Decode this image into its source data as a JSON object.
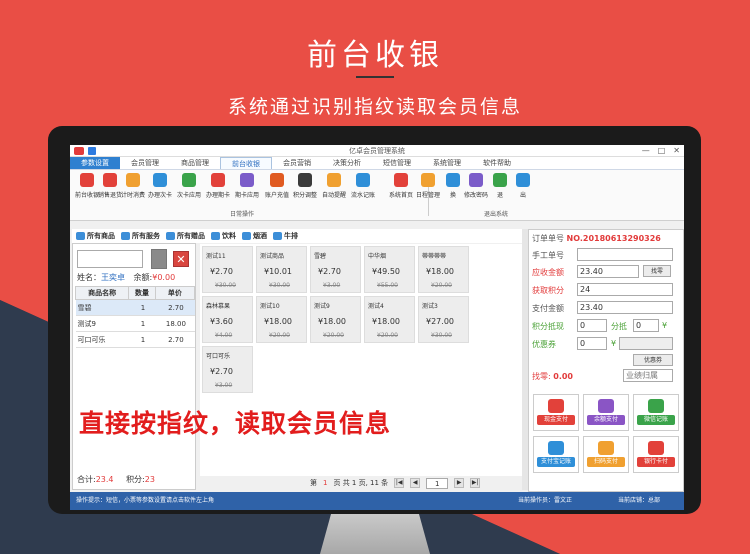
{
  "hero": {
    "title": "前台收银",
    "subtitle": "系统通过识别指纹读取会员信息"
  },
  "app": {
    "title": "亿卓会员管理系统",
    "min": "—",
    "max": "□",
    "close": "✕"
  },
  "menu": {
    "tabs": [
      "参数设置",
      "会员管理",
      "商品管理",
      "前台收银",
      "会员营销",
      "决策分析",
      "短信管理",
      "系统管理",
      "软件帮助"
    ]
  },
  "ribbon": {
    "buttons": [
      {
        "label": "前台收银",
        "color": "#e2413a"
      },
      {
        "label": "销售退货",
        "color": "#e2413a"
      },
      {
        "label": "计时消费",
        "color": "#f0a030"
      },
      {
        "label": "办理次卡",
        "color": "#2f8fd8"
      },
      {
        "label": "次卡应用",
        "color": "#3aa34a"
      },
      {
        "label": "办理期卡",
        "color": "#e2413a"
      },
      {
        "label": "期卡应用",
        "color": "#7b5cc9"
      },
      {
        "label": "账户充值",
        "color": "#e05a20"
      },
      {
        "label": "积分调整",
        "color": "#3a3a3a"
      },
      {
        "label": "自动提醒",
        "color": "#f0a030"
      },
      {
        "label": "流水记账",
        "color": "#2f8fd8"
      },
      {
        "label": "系统首页",
        "color": "#e2413a"
      },
      {
        "label": "日程管理",
        "color": "#f0a030"
      },
      {
        "label": "换",
        "color": "#2f8fd8"
      },
      {
        "label": "修改密码",
        "color": "#7b5cc9"
      },
      {
        "label": "退",
        "color": "#3aa34a"
      },
      {
        "label": "出",
        "color": "#2f8fd8"
      }
    ],
    "group1": "日常操作",
    "group2": "退出系统"
  },
  "categories": [
    "所有商品",
    "所有服务",
    "所有赠品",
    "饮料",
    "烟酒",
    "牛排"
  ],
  "member": {
    "name_label": "姓名：",
    "name": "王奕卓",
    "balance_label": "余额:",
    "balance": "¥0.00"
  },
  "cart": {
    "headers": [
      "商品名称",
      "数量",
      "单价"
    ],
    "rows": [
      {
        "name": "雪碧",
        "qty": "1",
        "price": "2.70"
      },
      {
        "name": "测试9",
        "qty": "1",
        "price": "18.00"
      },
      {
        "name": "可口可乐",
        "qty": "1",
        "price": "2.70"
      }
    ],
    "total_label": "合计:",
    "total": "23.4",
    "points_label": "积分:",
    "points": "23"
  },
  "products": [
    {
      "name": "测试11",
      "price": "¥2.70",
      "old": "¥30.00"
    },
    {
      "name": "测试商品",
      "price": "¥10.01",
      "old": "¥30.00"
    },
    {
      "name": "雪碧",
      "price": "¥2.70",
      "old": "¥3.00"
    },
    {
      "name": "中华烟",
      "price": "¥49.50",
      "old": "¥55.00"
    },
    {
      "name": "蒂蒂蒂蒂",
      "price": "¥18.00",
      "old": "¥20.00"
    },
    {
      "name": "森林慕果",
      "price": "¥3.60",
      "old": "¥4.00"
    },
    {
      "name": "测试10",
      "price": "¥18.00",
      "old": "¥20.00"
    },
    {
      "name": "测试9",
      "price": "¥18.00",
      "old": "¥20.00"
    },
    {
      "name": "测试4",
      "price": "¥18.00",
      "old": "¥20.00"
    },
    {
      "name": "测试3",
      "price": "¥27.00",
      "old": "¥30.00"
    },
    {
      "name": "可口可乐",
      "price": "¥2.70",
      "old": "¥3.00"
    }
  ],
  "pager": {
    "prefix": "第",
    "page": "1",
    "mid": "页 共 1 页, 11 条",
    "input": "1",
    "first": "|◀",
    "prev": "◀",
    "next": "▶",
    "last": "▶|"
  },
  "checkout": {
    "order_label": "订单单号",
    "order_no": "NO.20180613290326",
    "clerk_label": "手工单号",
    "clerk": "",
    "due_label": "应收金额",
    "due": "23.40",
    "hint_btn": "找零",
    "points_label": "获取积分",
    "points": "24",
    "pay_label": "支付金额",
    "pay": "23.40",
    "deduct_label": "积分抵现",
    "deduct": "0",
    "minute_label": "分抵",
    "minute": "0",
    "yen": "¥",
    "coupon_label": "优惠券",
    "coupon": "0",
    "coupon_btn": "优惠券",
    "change_label": "找零:",
    "change": "0.00",
    "continue": "业绩归属"
  },
  "payments": [
    {
      "label": "现金支付",
      "color": "#e2413a"
    },
    {
      "label": "余额支付",
      "color": "#8a55c5"
    },
    {
      "label": "微信记账",
      "color": "#3aa34a"
    },
    {
      "label": "支付宝记账",
      "color": "#2f8fd8"
    },
    {
      "label": "扫码支付",
      "color": "#f0a030"
    },
    {
      "label": "银行卡付",
      "color": "#e2413a"
    }
  ],
  "statusbar": {
    "left": "操作提示：短信，小票等参数设置请点击软件左上角",
    "operator": "当前操作员：雷文正",
    "store": "当前店铺：总部"
  },
  "overlay": "直接按指纹，读取会员信息"
}
